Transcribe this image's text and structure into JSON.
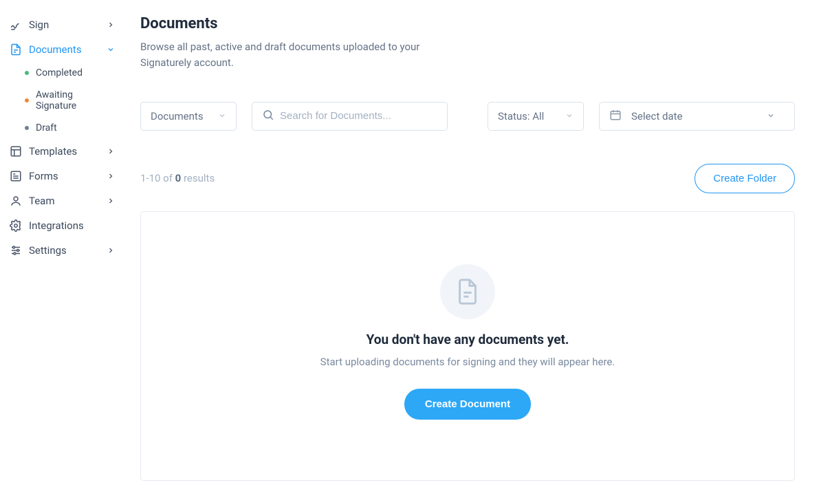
{
  "sidebar": {
    "items": [
      {
        "label": "Sign"
      },
      {
        "label": "Documents"
      },
      {
        "label": "Templates"
      },
      {
        "label": "Forms"
      },
      {
        "label": "Team"
      },
      {
        "label": "Integrations"
      },
      {
        "label": "Settings"
      }
    ],
    "documents_sub": [
      {
        "label": "Completed"
      },
      {
        "label": "Awaiting Signature"
      },
      {
        "label": "Draft"
      }
    ]
  },
  "page": {
    "title": "Documents",
    "subtitle": "Browse all past, active and draft documents uploaded to your Signaturely account."
  },
  "filters": {
    "type": "Documents",
    "search_placeholder": "Search for Documents...",
    "status": "Status: All",
    "date": "Select date"
  },
  "results": {
    "prefix": "1-10 of ",
    "count": "0",
    "suffix": " results"
  },
  "buttons": {
    "create_folder": "Create Folder",
    "create_document": "Create Document"
  },
  "empty": {
    "title": "You don't have any documents yet.",
    "subtitle": "Start uploading documents for signing and they will appear here."
  }
}
